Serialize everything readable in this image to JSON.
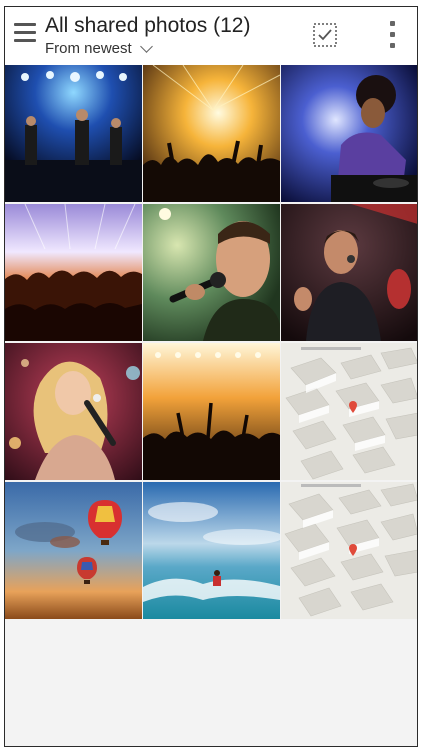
{
  "header": {
    "title": "All shared photos (12)",
    "sort_label": "From newest",
    "icons": [
      "menu-icon",
      "select-checkbox-icon",
      "more-vertical-icon"
    ]
  },
  "photos": [
    {
      "subject": "concert-stage-band"
    },
    {
      "subject": "concert-crowd-lights"
    },
    {
      "subject": "dj-at-turntable"
    },
    {
      "subject": "stage-crowd"
    },
    {
      "subject": "singer-microphone"
    },
    {
      "subject": "rock-singer"
    },
    {
      "subject": "woman-singer"
    },
    {
      "subject": "concert-crowd-golden"
    },
    {
      "subject": "map-3d-city"
    },
    {
      "subject": "hot-air-balloons"
    },
    {
      "subject": "jet-ski-ocean"
    },
    {
      "subject": "map-3d-city"
    }
  ],
  "colors": {
    "accent": "#444444",
    "background": "#f3f3f3"
  }
}
